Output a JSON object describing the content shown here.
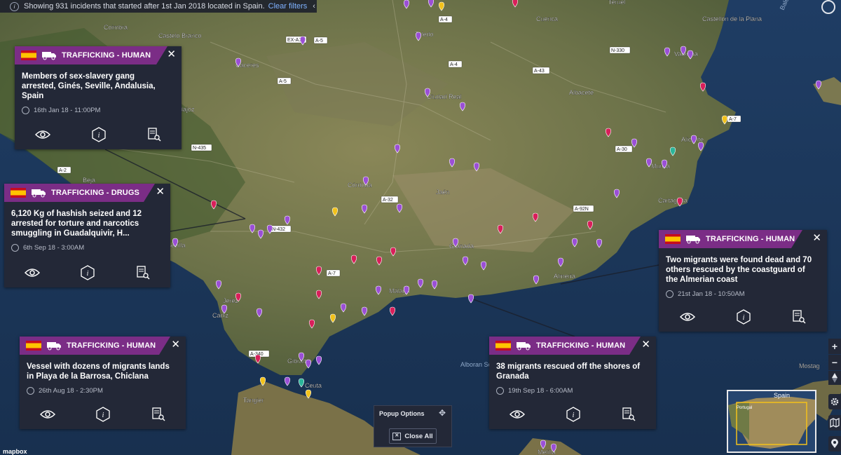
{
  "filter_bar": {
    "text": "Showing 931 incidents that started after 1st Jan 2018 located in Spain.",
    "clear_label": "Clear filters"
  },
  "popups": [
    {
      "category": "TRAFFICKING - HUMAN",
      "title": "Members of sex-slavery gang arrested, Ginés, Seville, Andalusia, Spain",
      "time": "16th Jan 18 - 11:00PM"
    },
    {
      "category": "TRAFFICKING - DRUGS",
      "title": "6,120 Kg of hashish seized and 12 arrested for torture and narcotics smuggling in Guadalquivir, H...",
      "time": "6th Sep 18 - 3:00AM"
    },
    {
      "category": "TRAFFICKING - HUMAN",
      "title": "Two migrants were found dead and 70 others rescued by the coastguard of the Almerian coast",
      "time": "21st Jan 18 - 10:50AM"
    },
    {
      "category": "TRAFFICKING - HUMAN",
      "title": "Vessel with dozens of migrants lands in Playa de la Barrosa, Chiclana",
      "time": "26th Aug 18 - 2:30PM"
    },
    {
      "category": "TRAFFICKING - HUMAN",
      "title": "38 migrants rescued off the shores of Granada",
      "time": "19th Sep 18 - 6:00AM"
    }
  ],
  "popup_options": {
    "label": "Popup Options",
    "close_all": "Close All"
  },
  "map_labels": [
    "Coimbra",
    "Plasencia",
    "Castelo Branco",
    "Toledo",
    "Cuenca",
    "Castellón de la Plana",
    "Cáceres",
    "Badajoz",
    "Ciudad Real",
    "Albacete",
    "Valencia",
    "Beja",
    "Córdoba",
    "Jaén",
    "Murcia",
    "Alicante",
    "Cartagena",
    "Sevilla",
    "Granada",
    "Almería",
    "Málaga",
    "Jerez",
    "Cádiz",
    "Gibraltar",
    "Ceuta",
    "Tangier",
    "Alboran Sea",
    "Balearic Sea",
    "Mostag",
    "Melilla",
    "Teruel"
  ],
  "road_labels": [
    "EX-A1",
    "A-5",
    "A-5",
    "A-4",
    "A-43",
    "N-330",
    "N-435",
    "A-2",
    "A-30",
    "A-32",
    "A-92N",
    "A-7",
    "A-7",
    "A-340",
    "N-432",
    "A-4"
  ],
  "minimap": {
    "label_spain": "Spain",
    "label_portugal": "Portugal"
  },
  "zoom": {
    "in": "+",
    "out": "−"
  },
  "attribution": "mapbox",
  "colors": {
    "popup_bg": "#232837",
    "category_band": "#7b2d86",
    "marker_purple": "#9b4fd6",
    "marker_red": "#d81f5a",
    "marker_yellow": "#f2c21b",
    "marker_teal": "#2bb59a"
  }
}
